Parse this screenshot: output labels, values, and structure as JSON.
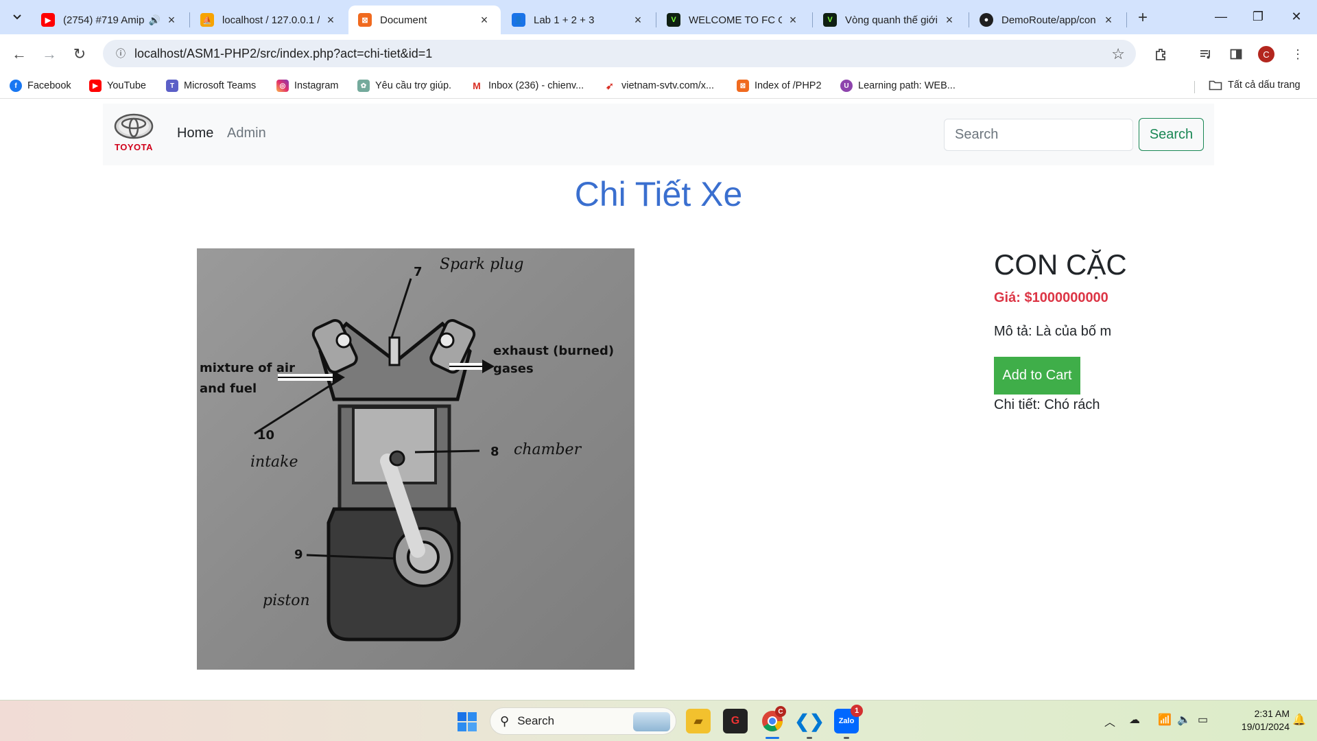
{
  "browser": {
    "tabs": [
      {
        "title": "(2754) #719 Amip",
        "icon": "youtube-icon"
      },
      {
        "title": "localhost / 127.0.0.1 /",
        "icon": "phpmyadmin-icon"
      },
      {
        "title": "Document",
        "icon": "xampp-icon",
        "active": true
      },
      {
        "title": "Lab 1 + 2 + 3",
        "icon": "classroom-icon"
      },
      {
        "title": "WELCOME TO FC ON",
        "icon": "fc-online-icon"
      },
      {
        "title": "Vòng quanh thế giới",
        "icon": "fc-online-icon"
      },
      {
        "title": "DemoRoute/app/con",
        "icon": "github-icon"
      }
    ],
    "url": "localhost/ASM1-PHP2/src/index.php?act=chi-tiet&id=1",
    "profile_initial": "C",
    "bookmarks": [
      {
        "label": "Facebook",
        "icon": "facebook-icon"
      },
      {
        "label": "YouTube",
        "icon": "youtube-icon"
      },
      {
        "label": "Microsoft Teams",
        "icon": "teams-icon"
      },
      {
        "label": "Instagram",
        "icon": "instagram-icon"
      },
      {
        "label": "Yêu cầu trợ giúp.",
        "icon": "chatgpt-icon"
      },
      {
        "label": "Inbox (236) - chienv...",
        "icon": "gmail-icon"
      },
      {
        "label": "vietnam-svtv.com/x...",
        "icon": "link-icon"
      },
      {
        "label": "Index of /PHP2",
        "icon": "xampp-icon"
      },
      {
        "label": "Learning path: WEB...",
        "icon": "learning-icon"
      }
    ],
    "all_bookmarks_label": "Tất cả dấu trang"
  },
  "site": {
    "brand": "TOYOTA",
    "nav": {
      "home": "Home",
      "admin": "Admin"
    },
    "search": {
      "placeholder": "Search",
      "button": "Search"
    },
    "page_title": "Chi Tiết Xe"
  },
  "product": {
    "image_labels": {
      "spark": "Spark plug",
      "n7": "7",
      "mixture": "mixture of air\nand fuel",
      "exhaust": "exhaust (burned)\ngases",
      "n10": "10",
      "intake": "intake",
      "n8": "8",
      "chamber": "chamber",
      "n9": "9",
      "piston": "piston"
    },
    "name": "CON CẶC",
    "price": "Giá: $1000000000",
    "description": "Mô tả: Là của bố m",
    "add_to_cart": "Add to Cart",
    "detail": "Chi tiết: Chó rách"
  },
  "taskbar": {
    "search_label": "Search",
    "time": "2:31 AM",
    "date": "19/01/2024",
    "chrome_badge": "C",
    "zalo_badge": "1"
  },
  "colors": {
    "title_blue": "#3a6fcf",
    "price_red": "#dc3545",
    "cart_green": "#3fae49",
    "search_green": "#198754"
  }
}
